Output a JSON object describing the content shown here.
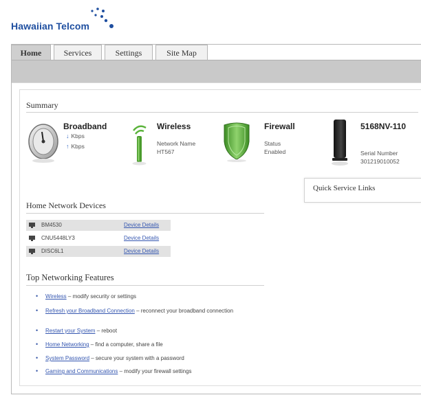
{
  "brand": {
    "logo_text": "Hawaiian Telcom",
    "colors": {
      "brand_blue": "#1f4fa0",
      "link_blue": "#3456b0",
      "green": "#5ab33a"
    }
  },
  "tabs": [
    {
      "label": "Home",
      "active": true
    },
    {
      "label": "Services",
      "active": false
    },
    {
      "label": "Settings",
      "active": false
    },
    {
      "label": "Site Map",
      "active": false
    }
  ],
  "summary": {
    "title": "Summary",
    "broadband": {
      "title": "Broadband",
      "down": "Kbps",
      "up": "Kbps",
      "icon": "gauge-icon"
    },
    "wireless": {
      "title": "Wireless",
      "name_label": "Network Name",
      "name_value": "HT567",
      "icon": "wifi-antenna-icon"
    },
    "firewall": {
      "title": "Firewall",
      "status_label": "Status",
      "status_value": "Enabled",
      "icon": "shield-icon"
    },
    "gateway": {
      "title": "5168NV-110",
      "serial_label": "Serial Number",
      "serial_value": "301219010052",
      "icon": "gateway-device-icon"
    }
  },
  "quick_links": {
    "title": "Quick Service Links"
  },
  "devices": {
    "title": "Home Network Devices",
    "rows": [
      {
        "name": "BM4530",
        "link": "Device Details",
        "shaded": true
      },
      {
        "name": "CNU5448LY3",
        "link": "Device Details",
        "shaded": false
      },
      {
        "name": "DISC6L1",
        "link": "Device Details",
        "shaded": true
      }
    ]
  },
  "features": {
    "title": "Top Networking Features",
    "items": [
      {
        "link": "Wireless",
        "text": " – modify security or settings"
      },
      {
        "link": "Refresh your Broadband Connection",
        "text": " – reconnect your broadband connection"
      },
      {
        "link": "Restart your System",
        "text": " – reboot"
      },
      {
        "link": "Home Networking",
        "text": " – find a computer, share a file"
      },
      {
        "link": "System Password",
        "text": " – secure your system with a password"
      },
      {
        "link": "Gaming and Communications",
        "text": " – modify your firewall settings"
      }
    ]
  }
}
